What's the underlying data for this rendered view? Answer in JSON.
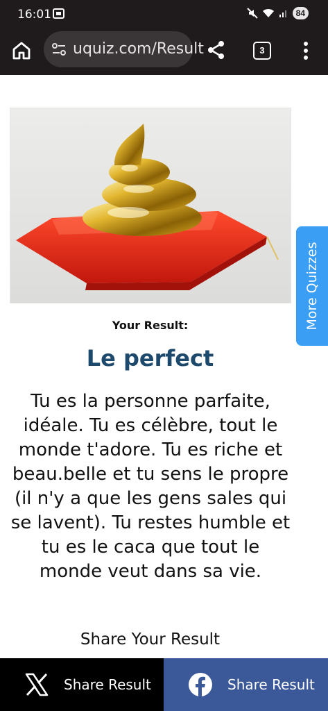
{
  "status_bar": {
    "time": "16:01",
    "battery": "84"
  },
  "browser": {
    "url": "uquiz.com/Result",
    "tab_count": "3"
  },
  "result": {
    "kicker": "Your Result:",
    "title": "Le perfect",
    "description": "Tu es la personne parfaite, idéale. Tu es célèbre, tout le monde t'adore. Tu es riche et beau.belle et tu sens le propre (il n'y a que les gens sales qui se lavent). Tu restes humble et tu es le caca que tout le monde veut dans sa vie.",
    "share_heading": "Share Your Result"
  },
  "side_tab": {
    "label": "More Quizzes"
  },
  "share_bar": {
    "x_label": "Share Result",
    "facebook_label": "Share Result"
  },
  "colors": {
    "title": "#1d4a6c",
    "side_tab": "#3b9ef5",
    "facebook": "#3b5998",
    "browser_chrome": "#1f1b1c"
  },
  "icons": {
    "home": "home-icon",
    "site_settings": "site-settings-icon",
    "share": "share-icon",
    "menu": "more-vert-icon",
    "x": "x-logo-icon",
    "facebook": "facebook-logo-icon"
  }
}
